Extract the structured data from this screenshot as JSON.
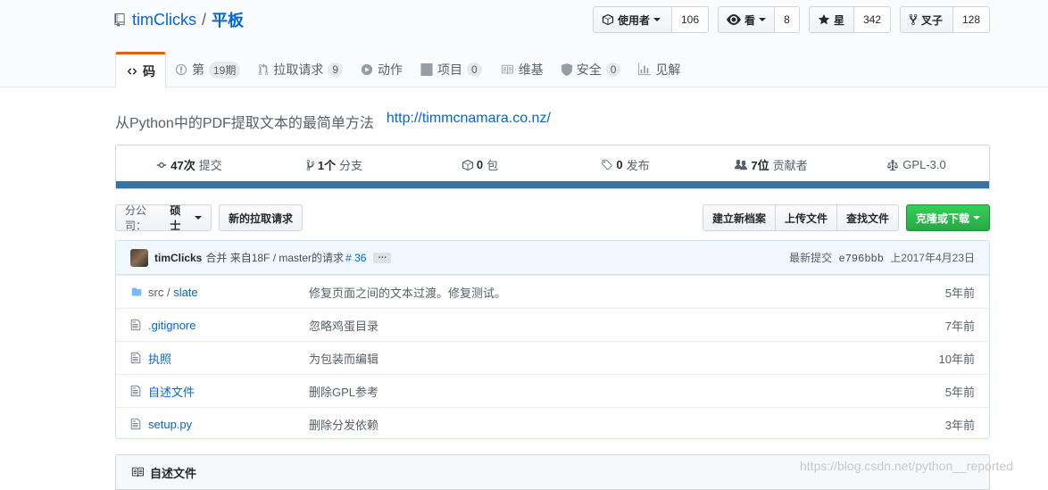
{
  "repo": {
    "owner": "timClicks",
    "separator": "/",
    "name": "平板"
  },
  "actions": {
    "watch": {
      "label": "使用者",
      "count": "106"
    },
    "view": {
      "label": "看",
      "count": "8"
    },
    "star": {
      "label": "星",
      "count": "342"
    },
    "fork": {
      "label": "叉子",
      "count": "128"
    }
  },
  "tabs": [
    {
      "label": "码"
    },
    {
      "label": "第",
      "badge": "19期"
    },
    {
      "label": "拉取请求",
      "badge": "9"
    },
    {
      "label": "动作"
    },
    {
      "label": "项目",
      "badge": "0"
    },
    {
      "label": "维基"
    },
    {
      "label": "安全",
      "badge": "0"
    },
    {
      "label": "见解"
    }
  ],
  "description": {
    "text": "从Python中的PDF提取文本的最简单方法",
    "url": "http://timmcnamara.co.nz/"
  },
  "summary": {
    "commits": {
      "num": "47次",
      "label": "提交"
    },
    "branches": {
      "num": "1个",
      "label": "分支"
    },
    "packages": {
      "num": "0",
      "label": "包"
    },
    "releases": {
      "num": "0",
      "label": "发布"
    },
    "contributors": {
      "num": "7位",
      "label": "贡献者"
    },
    "license": {
      "label": "GPL-3.0"
    },
    "language_color": "#3572A5"
  },
  "toolbar": {
    "branch_label": "分公司：",
    "branch_value": "硕士",
    "new_pr": "新的拉取请求",
    "create_file": "建立新档案",
    "upload_files": "上传文件",
    "find_file": "查找文件",
    "clone": "克隆或下载"
  },
  "commit": {
    "author": "timClicks",
    "message": "合并 来自18F / master的请求",
    "pr": "# 36",
    "ellipsis": "…",
    "latest_label": "最新提交",
    "sha": "e796bbb",
    "date": "上2017年4月23日"
  },
  "files": [
    {
      "type": "dir",
      "dir": "src",
      "sep": " / ",
      "name": "slate",
      "message": "修复页面之间的文本过渡。修复测试。",
      "age": "5年前"
    },
    {
      "type": "file",
      "dir": "",
      "sep": "",
      "name": ".gitignore",
      "message": "忽略鸡蛋目录",
      "age": "7年前"
    },
    {
      "type": "file",
      "dir": "",
      "sep": "",
      "name": "执照",
      "message": "为包装而编辑",
      "age": "10年前"
    },
    {
      "type": "file",
      "dir": "",
      "sep": "",
      "name": "自述文件",
      "message": "删除GPL参考",
      "age": "5年前"
    },
    {
      "type": "file",
      "dir": "",
      "sep": "",
      "name": "setup.py",
      "message": "删除分发依赖",
      "age": "3年前"
    }
  ],
  "readme": {
    "title": "自述文件"
  },
  "watermark": "https://blog.csdn.net/python__reported"
}
